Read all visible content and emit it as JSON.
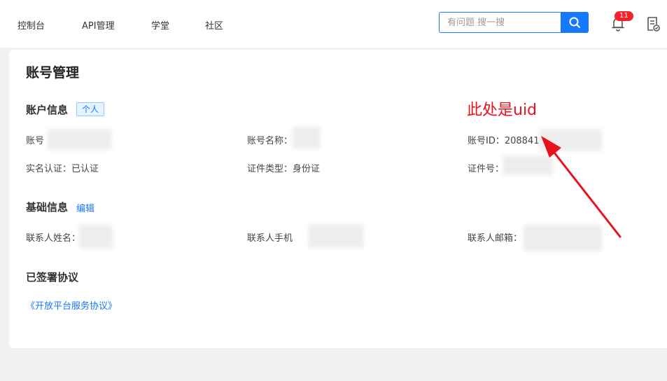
{
  "nav": {
    "items": [
      "控制台",
      "API管理",
      "学堂",
      "社区"
    ],
    "search_placeholder": "有问题 搜一搜",
    "notification_count": "11"
  },
  "page": {
    "title": "账号管理"
  },
  "account_info": {
    "title": "账户信息",
    "tag": "个人",
    "account_label": "账号",
    "account_name_label": "账号名称：",
    "account_id_label": "账号ID：",
    "account_id_visible": "208841",
    "realname_label": "实名认证：",
    "realname_value": "已认证",
    "id_type_label": "证件类型：",
    "id_type_value": "身份证",
    "id_number_label": "证件号："
  },
  "basic_info": {
    "title": "基础信息",
    "edit_link": "编辑",
    "contact_name_label": "联系人姓名：",
    "contact_phone_label": "联系人手机",
    "contact_email_label": "联系人邮箱："
  },
  "agreements": {
    "title": "已签署协议",
    "items": [
      "《开放平台服务协议》"
    ]
  },
  "annotation": {
    "text": "此处是uid",
    "color": "#e8121e"
  },
  "colors": {
    "accent": "#1677ff",
    "badge": "#f5222d"
  }
}
